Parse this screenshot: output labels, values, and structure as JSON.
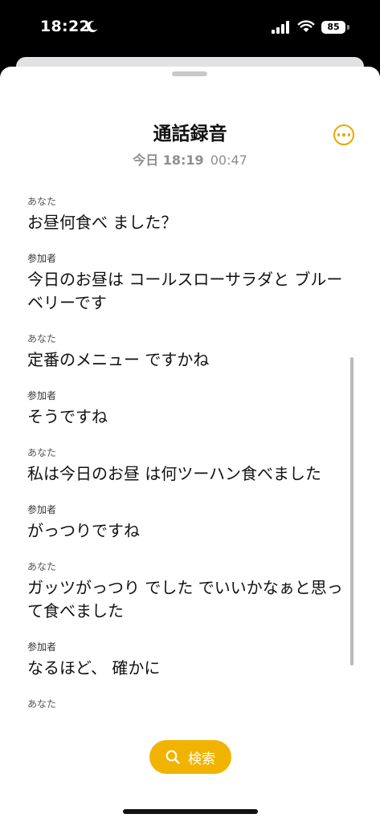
{
  "status_bar": {
    "time": "18:22",
    "battery": "85"
  },
  "header": {
    "title": "通話録音",
    "date": "今日 18:19",
    "duration": "00:47"
  },
  "transcript": [
    {
      "speaker": "あなた",
      "text": "お昼何食べ ました？"
    },
    {
      "speaker": "参加者",
      "text": "今日のお昼は コールスローサラダと ブルーベリーです"
    },
    {
      "speaker": "あなた",
      "text": "定番のメニュー ですかね"
    },
    {
      "speaker": "参加者",
      "text": "そうですね"
    },
    {
      "speaker": "あなた",
      "text": "私は今日のお昼 は何ツーハン食べました"
    },
    {
      "speaker": "参加者",
      "text": "がっつりですね"
    },
    {
      "speaker": "あなた",
      "text": "ガッツがっつり でした でいいかなぁと思って食べました"
    },
    {
      "speaker": "参加者",
      "text": "なるほど、 確かに"
    },
    {
      "speaker": "あなた",
      "text": ""
    }
  ],
  "search": {
    "label": "検索"
  },
  "colors": {
    "accent": "#f0b400",
    "background": "#ffffff",
    "text": "#111111"
  }
}
